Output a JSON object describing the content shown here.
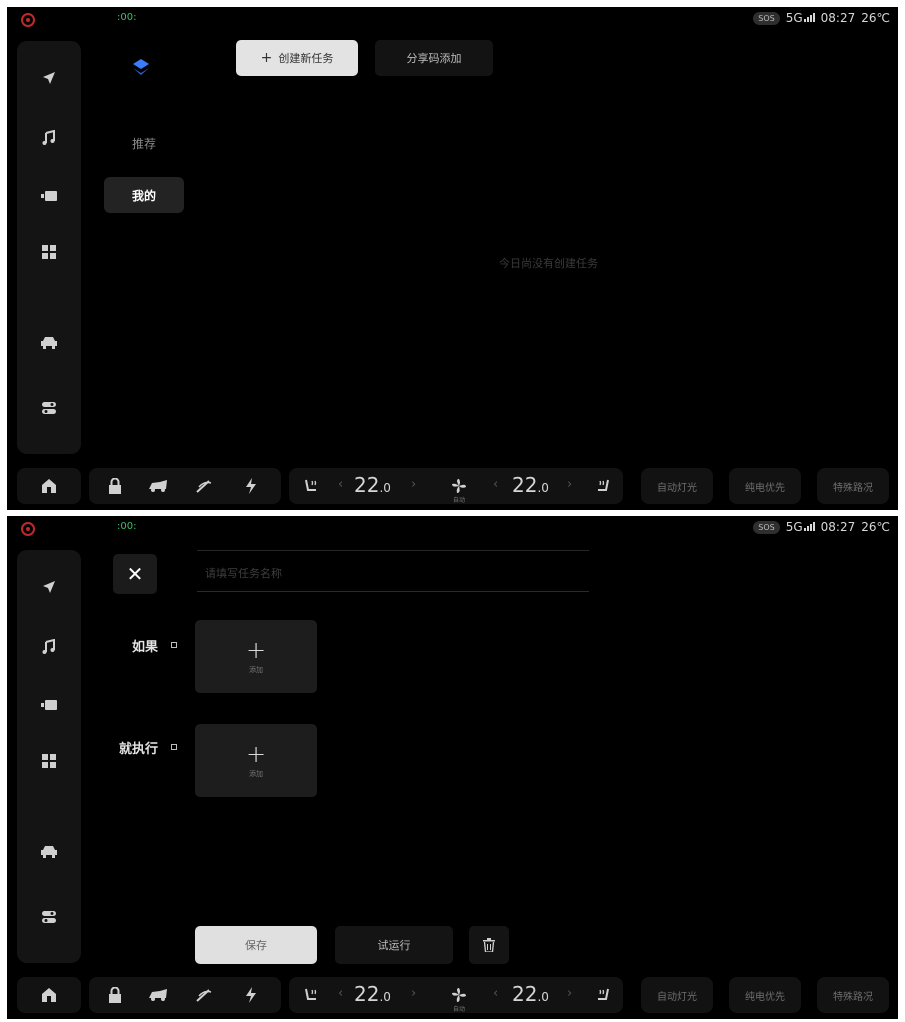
{
  "status_bar": {
    "left_indicator": ":00:",
    "sos": "SOS",
    "network": "5G",
    "time": "08:27",
    "temperature": "26℃"
  },
  "rail_icons": [
    "navigation-icon",
    "music-icon",
    "video-icon",
    "apps-icon",
    "car-icon",
    "toggle-icon"
  ],
  "dock": {
    "driver_temp": "22",
    "driver_temp_decimal": ".0",
    "passenger_temp": "22",
    "passenger_temp_decimal": ".0",
    "fan_mode": "自动",
    "btn_auto_light": "自动灯光",
    "btn_energy_priority": "纯电优先",
    "btn_road_condition": "特殊路况"
  },
  "screen1": {
    "create_button": "创建新任务",
    "create_plus": "+",
    "share_button": "分享码添加",
    "categories": [
      {
        "label": "推荐",
        "active": false
      },
      {
        "label": "我的",
        "active": true
      }
    ],
    "empty_message": "今日尚没有创建任务"
  },
  "screen2": {
    "close_symbol": "✕",
    "name_input_placeholder": "请填写任务名称",
    "condition_label": "如果",
    "condition_tile_plus": "+",
    "condition_tile_caption": "添加",
    "action_label": "就执行",
    "action_tile_plus": "+",
    "action_tile_caption": "添加",
    "save_button": "保存",
    "trial_button": "试运行"
  },
  "colors": {
    "background": "#000000",
    "panel": "#141414",
    "active_tab": "#232323",
    "primary_button": "#e3e3e3",
    "brand_red": "#c0282a",
    "status_green": "#3fbf6a"
  }
}
